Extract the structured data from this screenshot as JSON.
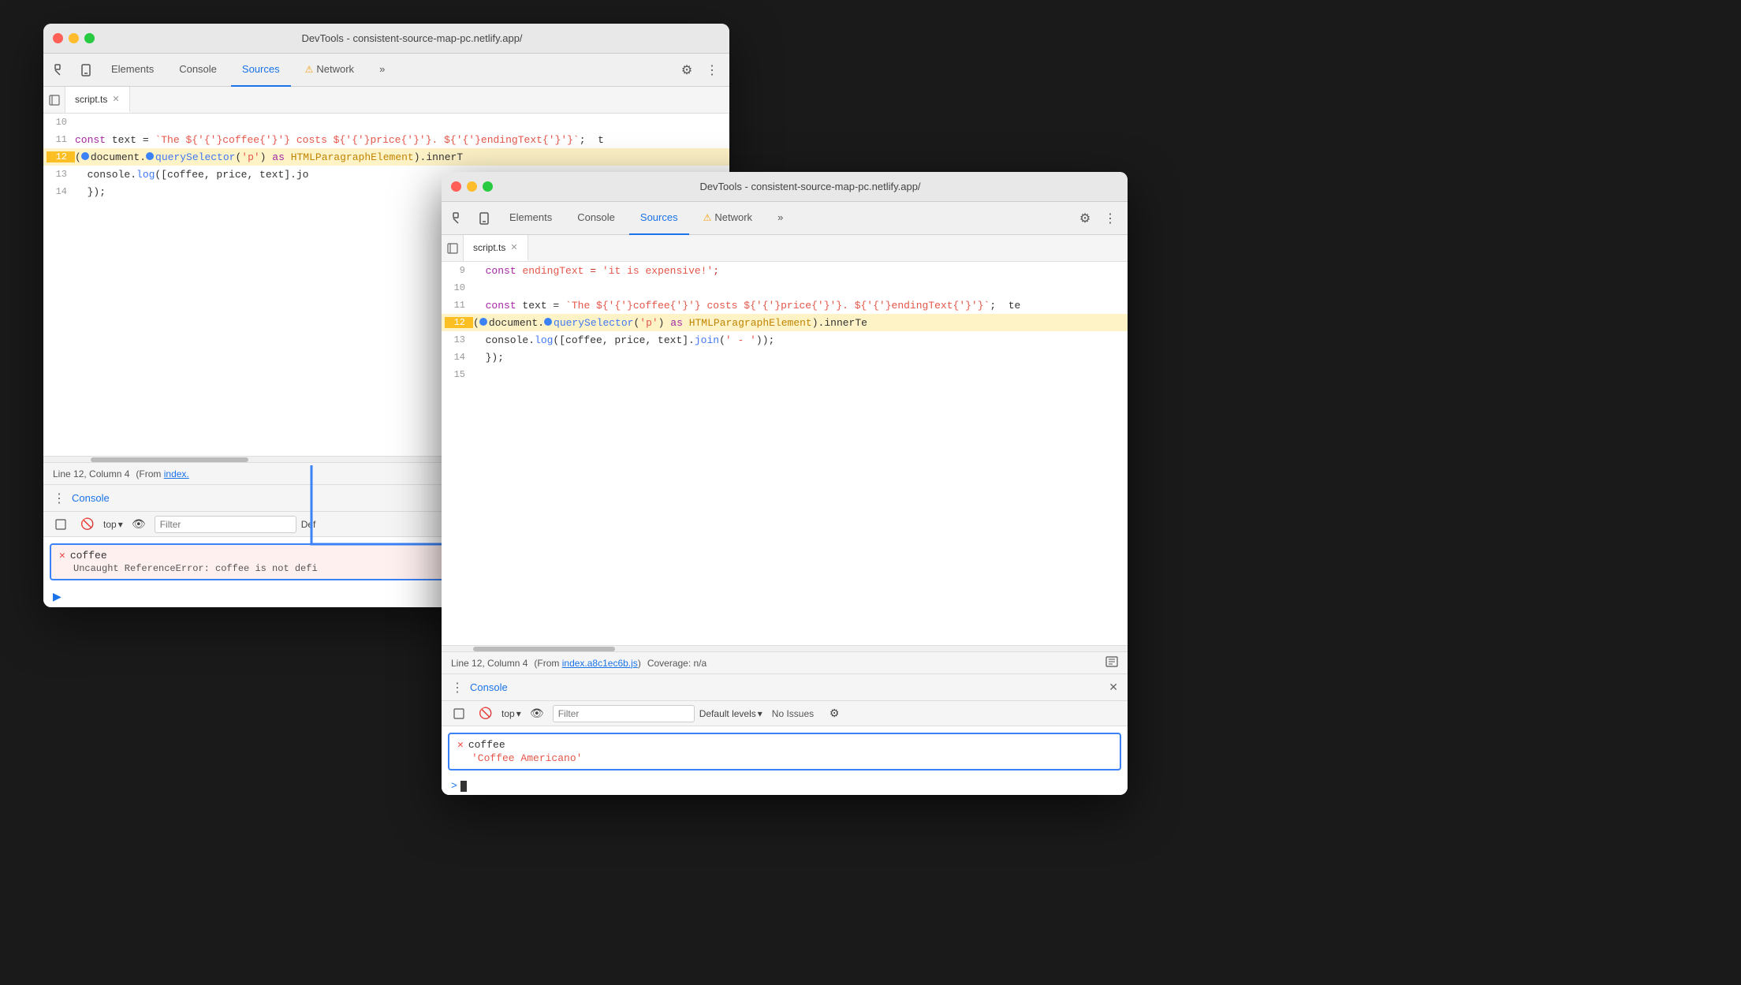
{
  "back_window": {
    "title": "DevTools - consistent-source-map-pc.netlify.app/",
    "tabs": [
      "Elements",
      "Console",
      "Sources",
      "Network"
    ],
    "active_tab": "Sources",
    "file_tab": "script.ts",
    "code_lines": [
      {
        "num": "10",
        "content": "",
        "highlight": false
      },
      {
        "num": "11",
        "content": "  const text = `The ${coffee} costs ${price}. ${endingText}`;  t",
        "highlight": false
      },
      {
        "num": "12",
        "content": "(▶document.▶querySelector('p') as HTMLParagraphElement).innerT",
        "highlight": true,
        "breakpoint": true
      },
      {
        "num": "13",
        "content": "  console.log([coffee, price, text].jo",
        "highlight": false
      },
      {
        "num": "14",
        "content": "  });",
        "highlight": false
      }
    ],
    "status": {
      "line_col": "Line 12, Column 4",
      "from_text": "(From index.",
      "link_text": "index.",
      "coverage": ""
    },
    "console": {
      "title": "Console",
      "filter_placeholder": "Filter",
      "top_label": "top",
      "error_header": "coffee",
      "error_msg": "Uncaught ReferenceError: coffee is not defi",
      "prompt_symbol": ">"
    }
  },
  "front_window": {
    "title": "DevTools - consistent-source-map-pc.netlify.app/",
    "tabs": [
      "Elements",
      "Console",
      "Sources",
      "Network"
    ],
    "active_tab": "Sources",
    "file_tab": "script.ts",
    "code_lines": [
      {
        "num": "9",
        "content": "  const endingText = 'it is expensive!';",
        "highlight": false,
        "color": "red"
      },
      {
        "num": "10",
        "content": "",
        "highlight": false
      },
      {
        "num": "11",
        "content": "  const text = `The ${coffee} costs ${price}. ${endingText}`;  te",
        "highlight": false
      },
      {
        "num": "12",
        "content": "(▶document.▶querySelector('p') as HTMLParagraphElement).innerTe",
        "highlight": true,
        "breakpoint": true
      },
      {
        "num": "13",
        "content": "  console.log([coffee, price, text].join(' - '));",
        "highlight": false
      },
      {
        "num": "14",
        "content": "  });",
        "highlight": false
      },
      {
        "num": "15",
        "content": "",
        "highlight": false
      }
    ],
    "status": {
      "line_col": "Line 12, Column 4",
      "from_text": "(From ",
      "link_text": "index.a8c1ec6b.js",
      "coverage_label": "Coverage: n/a"
    },
    "console": {
      "title": "Console",
      "filter_placeholder": "Filter",
      "top_label": "top",
      "default_levels": "Default levels",
      "no_issues": "No Issues",
      "success_header": "coffee",
      "success_val": "'Coffee Americano'",
      "prompt_symbol": ">"
    }
  },
  "icons": {
    "gear": "⚙",
    "more": "⋮",
    "close": "✕",
    "warn": "⚠",
    "eye": "👁",
    "block": "🚫",
    "chevron_down": "▾",
    "breakpoint": "⬤",
    "expand": "▶",
    "sidebar_toggle": "⊞",
    "file_icon": "📄",
    "console_toggle": "⊡",
    "caret": "›",
    "ellipsis": "⋮"
  },
  "colors": {
    "accent_blue": "#1a73e8",
    "error_red": "#e44",
    "highlight_yellow": "#fef3c7",
    "highlight_yellow_marker": "#fbbf24",
    "arrow_blue": "#3b82f6",
    "success_orange": "#e45649"
  }
}
